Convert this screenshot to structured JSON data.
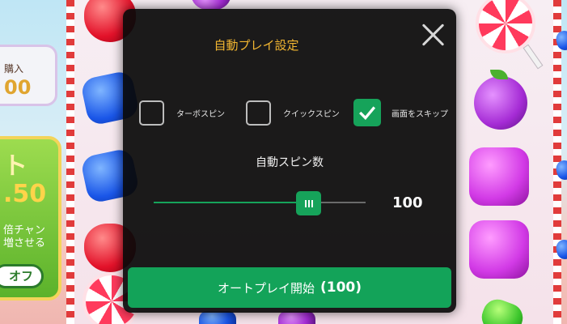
{
  "side_left": {
    "buy_label": "購入",
    "buy_amount": "00",
    "bonus_title": "ト",
    "bonus_value": ".50",
    "chance_line1": "倍チャン",
    "chance_line2": "増させる",
    "toggle_label": "オフ"
  },
  "dialog": {
    "title": "自動プレイ設定",
    "close_icon": "close-icon",
    "options": [
      {
        "label": "ターボスピン",
        "checked": false
      },
      {
        "label": "クイックスピン",
        "checked": false
      },
      {
        "label": "画面をスキップ",
        "checked": true
      }
    ],
    "spin_count_title": "自動スピン数",
    "spin_count_value": "100",
    "slider_fraction": 0.73,
    "start_button_label": "オートプレイ開始",
    "start_button_count": "(100)"
  },
  "colors": {
    "title_color": "#f2b631",
    "accent_green": "#13a359",
    "dialog_bg": "#0a0a0a"
  }
}
